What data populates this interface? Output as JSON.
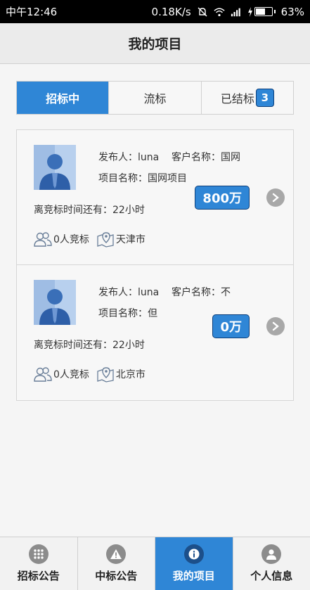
{
  "status_bar": {
    "time": "中午12:46",
    "network_speed": "0.18K/s",
    "battery_percent": "63%",
    "battery_level": 0.63,
    "icons": [
      "mute-icon",
      "wifi-icon",
      "signal-icon",
      "charging-icon",
      "battery-icon"
    ]
  },
  "header": {
    "title": "我的项目"
  },
  "tabs": [
    {
      "label": "招标中",
      "active": true
    },
    {
      "label": "流标",
      "active": false
    },
    {
      "label": "已结标",
      "active": false,
      "badge": "3"
    }
  ],
  "projects": [
    {
      "publisher_line": "发布人：luna",
      "client_line": "客户名称：国网",
      "project_line": "项目名称：国网项目",
      "amount": "800万",
      "deadline": "离竞标时间还有：22小时",
      "bidders": "0人竞标",
      "city": "天津市"
    },
    {
      "publisher_line": "发布人：luna",
      "client_line": "客户名称：不",
      "project_line": "项目名称：但",
      "amount": "0万",
      "deadline": "离竞标时间还有：22小时",
      "bidders": "0人竞标",
      "city": "北京市"
    }
  ],
  "bottom_nav": [
    {
      "label": "招标公告",
      "icon": "grid-icon",
      "active": false
    },
    {
      "label": "中标公告",
      "icon": "warning-icon",
      "active": false
    },
    {
      "label": "我的项目",
      "icon": "info-icon",
      "active": true
    },
    {
      "label": "个人信息",
      "icon": "person-icon",
      "active": false
    }
  ],
  "colors": {
    "accent": "#2f86d6",
    "badge_border": "#0d3f7a"
  }
}
